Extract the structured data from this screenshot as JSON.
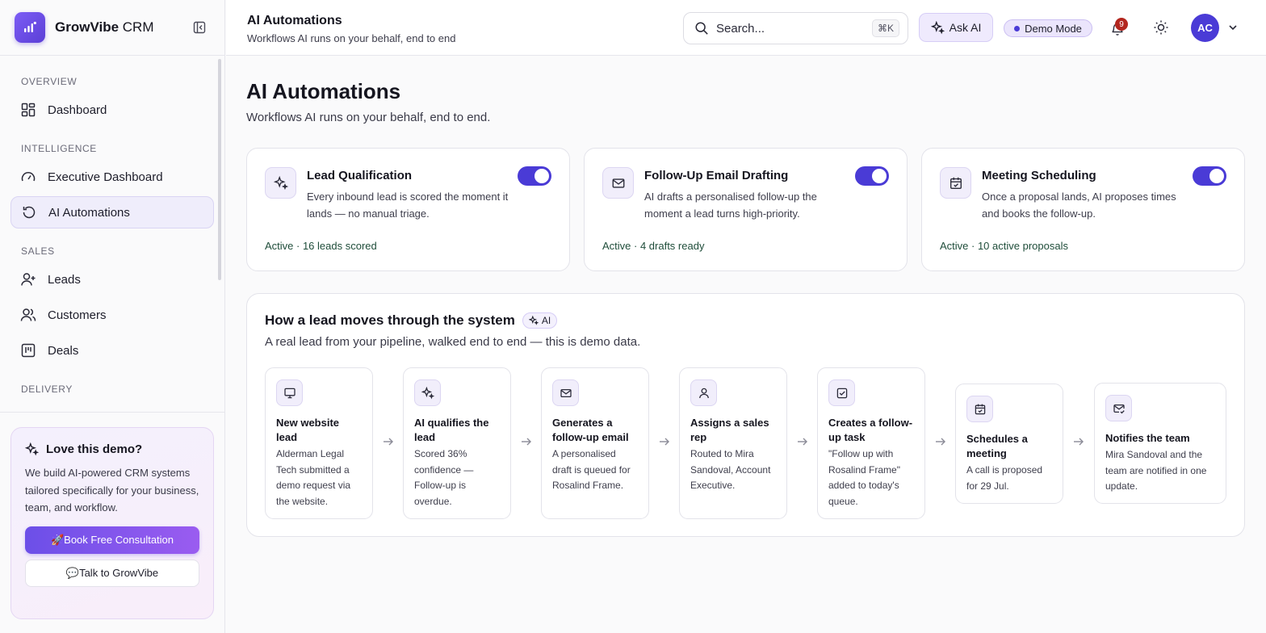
{
  "brand": {
    "name_bold": "GrowVibe",
    "name_light": " CRM"
  },
  "sidebar": {
    "sections": [
      {
        "label": "OVERVIEW",
        "items": [
          {
            "label": "Dashboard",
            "icon": "grid-icon"
          }
        ]
      },
      {
        "label": "INTELLIGENCE",
        "items": [
          {
            "label": "Executive Dashboard",
            "icon": "gauge-icon"
          },
          {
            "label": "AI Automations",
            "icon": "refresh-icon",
            "active": true
          }
        ]
      },
      {
        "label": "SALES",
        "items": [
          {
            "label": "Leads",
            "icon": "user-plus-icon"
          },
          {
            "label": "Customers",
            "icon": "users-icon"
          },
          {
            "label": "Deals",
            "icon": "kanban-icon"
          }
        ]
      },
      {
        "label": "DELIVERY",
        "items": []
      }
    ],
    "promo": {
      "title": "Love this demo?",
      "text": "We build AI-powered CRM systems tailored specifically for your business, team, and workflow.",
      "primary_label": "🚀Book Free Consultation",
      "secondary_label": "💬Talk to GrowVibe"
    }
  },
  "header": {
    "title": "AI Automations",
    "subtitle": "Workflows AI runs on your behalf, end to end",
    "search_placeholder": "Search...",
    "search_shortcut": "⌘K",
    "ask_ai_label": "Ask AI",
    "demo_mode_label": "Demo Mode",
    "notification_count": "9",
    "avatar_initials": "AC"
  },
  "main": {
    "title": "AI Automations",
    "subtitle": "Workflows AI runs on your behalf, end to end.",
    "automations": [
      {
        "title": "Lead Qualification",
        "description": "Every inbound lead is scored the moment it lands — no manual triage.",
        "status": "Active · 16 leads scored",
        "enabled": true,
        "icon": "sparkles-icon"
      },
      {
        "title": "Follow-Up Email Drafting",
        "description": "AI drafts a personalised follow-up the moment a lead turns high-priority.",
        "status": "Active · 4 drafts ready",
        "enabled": true,
        "icon": "mail-icon"
      },
      {
        "title": "Meeting Scheduling",
        "description": "Once a proposal lands, AI proposes times and books the follow-up.",
        "status": "Active · 10 active proposals",
        "enabled": true,
        "icon": "calendar-check-icon"
      }
    ],
    "flow": {
      "title": "How a lead moves through the system",
      "badge": "AI",
      "subtitle": "A real lead from your pipeline, walked end to end — this is demo data.",
      "steps": [
        {
          "title": "New website lead",
          "description": "Alderman Legal Tech submitted a demo request via the website.",
          "icon": "monitor-icon"
        },
        {
          "title": "AI qualifies the lead",
          "description": "Scored 36% confidence — Follow-up is overdue.",
          "icon": "sparkles-icon"
        },
        {
          "title": "Generates a follow-up email",
          "description": "A personalised draft is queued for Rosalind Frame.",
          "icon": "mail-icon"
        },
        {
          "title": "Assigns a sales rep",
          "description": "Routed to Mira Sandoval, Account Executive.",
          "icon": "user-icon"
        },
        {
          "title": "Creates a follow-up task",
          "description": "\"Follow up with Rosalind Frame\" added to today's queue.",
          "icon": "check-square-icon"
        },
        {
          "title": "Schedules a meeting",
          "description": "A call is proposed for 29 Jul.",
          "icon": "calendar-check-icon"
        },
        {
          "title": "Notifies the team",
          "description": "Mira Sandoval and the team are notified in one update.",
          "icon": "mail-check-icon"
        }
      ]
    }
  },
  "colors": {
    "accent": "#4a3bd6",
    "status_green": "#1f4d3a",
    "badge_red": "#b3261e"
  }
}
